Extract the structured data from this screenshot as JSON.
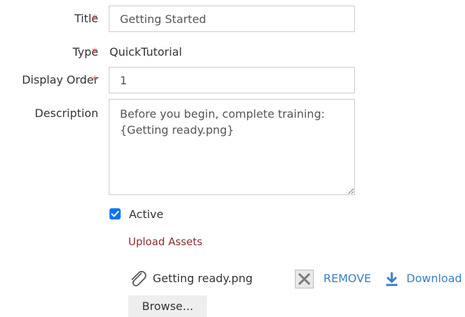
{
  "form": {
    "title": {
      "label": "Title",
      "required_mark": "*",
      "value": "Getting Started"
    },
    "type": {
      "label": "Type",
      "required_mark": "*",
      "value": "QuickTutorial"
    },
    "display_order": {
      "label": "Display Order",
      "required_mark": "*",
      "value": "1"
    },
    "description": {
      "label": "Description",
      "value": "Before you begin, complete training:\n{Getting ready.png}"
    },
    "active": {
      "label": "Active",
      "checked": true
    }
  },
  "assets": {
    "section_title": "Upload Assets",
    "files": [
      {
        "name": "Getting ready.png",
        "icon": "paperclip-icon",
        "remove_label": "REMOVE",
        "download_label": "Download"
      }
    ],
    "browse_label": "Browse..."
  },
  "colors": {
    "required": "#d9534f",
    "link": "#3a7fc1",
    "section_title": "#8b2d2d",
    "checkbox": "#0075ff"
  }
}
